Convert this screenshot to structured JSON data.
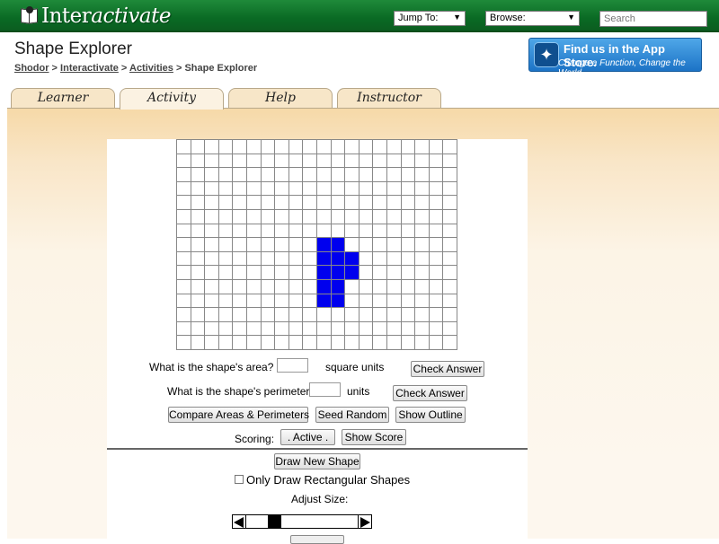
{
  "header": {
    "logo_prefix": "Inter",
    "logo_suffix": "activate",
    "jump_to_label": "Jump To:",
    "browse_label": "Browse:",
    "search_placeholder": "Search",
    "green": "#0a6a24"
  },
  "page": {
    "title": "Shape Explorer",
    "breadcrumb": [
      {
        "label": "Shodor",
        "link": true
      },
      {
        "label": "Interactivate",
        "link": true
      },
      {
        "label": "Activities",
        "link": true
      },
      {
        "label": "Shape Explorer",
        "link": false
      }
    ],
    "app_store": {
      "line1": "Find us in the App Store.",
      "line2": "Change a Function, Change the World"
    }
  },
  "tabs": [
    {
      "label": "Learner",
      "active": false
    },
    {
      "label": "Activity",
      "active": true
    },
    {
      "label": "Help",
      "active": false
    },
    {
      "label": "Instructor",
      "active": false
    }
  ],
  "grid": {
    "columns": 20,
    "rows": 15,
    "fill_color": "#0000ee",
    "filled_cells": [
      [
        10,
        7
      ],
      [
        11,
        7
      ],
      [
        10,
        8
      ],
      [
        11,
        8
      ],
      [
        12,
        8
      ],
      [
        10,
        9
      ],
      [
        11,
        9
      ],
      [
        12,
        9
      ],
      [
        10,
        10
      ],
      [
        11,
        10
      ],
      [
        10,
        11
      ],
      [
        11,
        11
      ]
    ]
  },
  "questions": {
    "area_label": "What is the shape's area?",
    "area_value": "",
    "area_units": "square units",
    "area_check": "Check Answer",
    "perimeter_label": "What is the shape's perimeter?",
    "perimeter_value": "",
    "perimeter_units": "units",
    "perimeter_check": "Check Answer"
  },
  "controls": {
    "compare_button": "Compare Areas & Perimeters",
    "seed_button": "Seed Random",
    "outline_button": "Show Outline",
    "scoring_label": "Scoring:",
    "active_button": ". Active .",
    "score_button": "Show Score",
    "draw_new_button": "Draw New Shape",
    "rect_only_label": "Only Draw Rectangular Shapes",
    "rect_only_checked": false,
    "adjust_size_label": "Adjust Size:",
    "size_slider_position": 0.22
  }
}
